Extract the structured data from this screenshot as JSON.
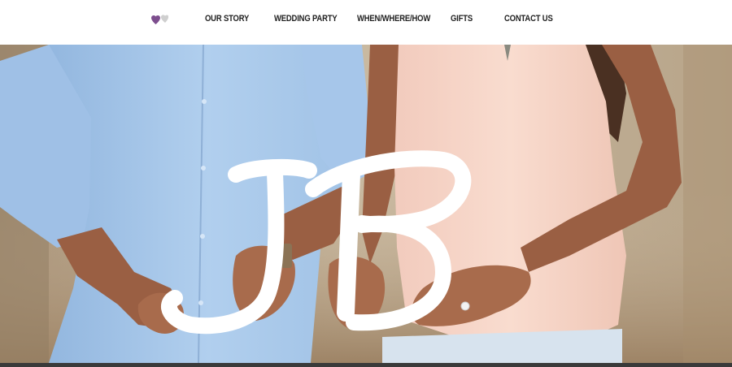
{
  "nav": {
    "logo_icon": "hearts-icon",
    "items": [
      {
        "label": "OUR STORY"
      },
      {
        "label": "WEDDING PARTY"
      },
      {
        "label": "WHEN/WHERE/HOW"
      },
      {
        "label": "GIFTS"
      },
      {
        "label": "CONTACT US"
      }
    ]
  },
  "hero": {
    "monogram": "JB",
    "colors": {
      "shirt": "#a9c9ea",
      "blouse": "#f6d4c6",
      "background": "#b9a68c",
      "skin": "#a86b4c",
      "letters": "#ffffff"
    }
  },
  "colors": {
    "nav_text": "#222222",
    "logo_purple": "#7d4e8e",
    "logo_grey": "#cfcfcf",
    "footer_bar": "#3a3a3a"
  }
}
